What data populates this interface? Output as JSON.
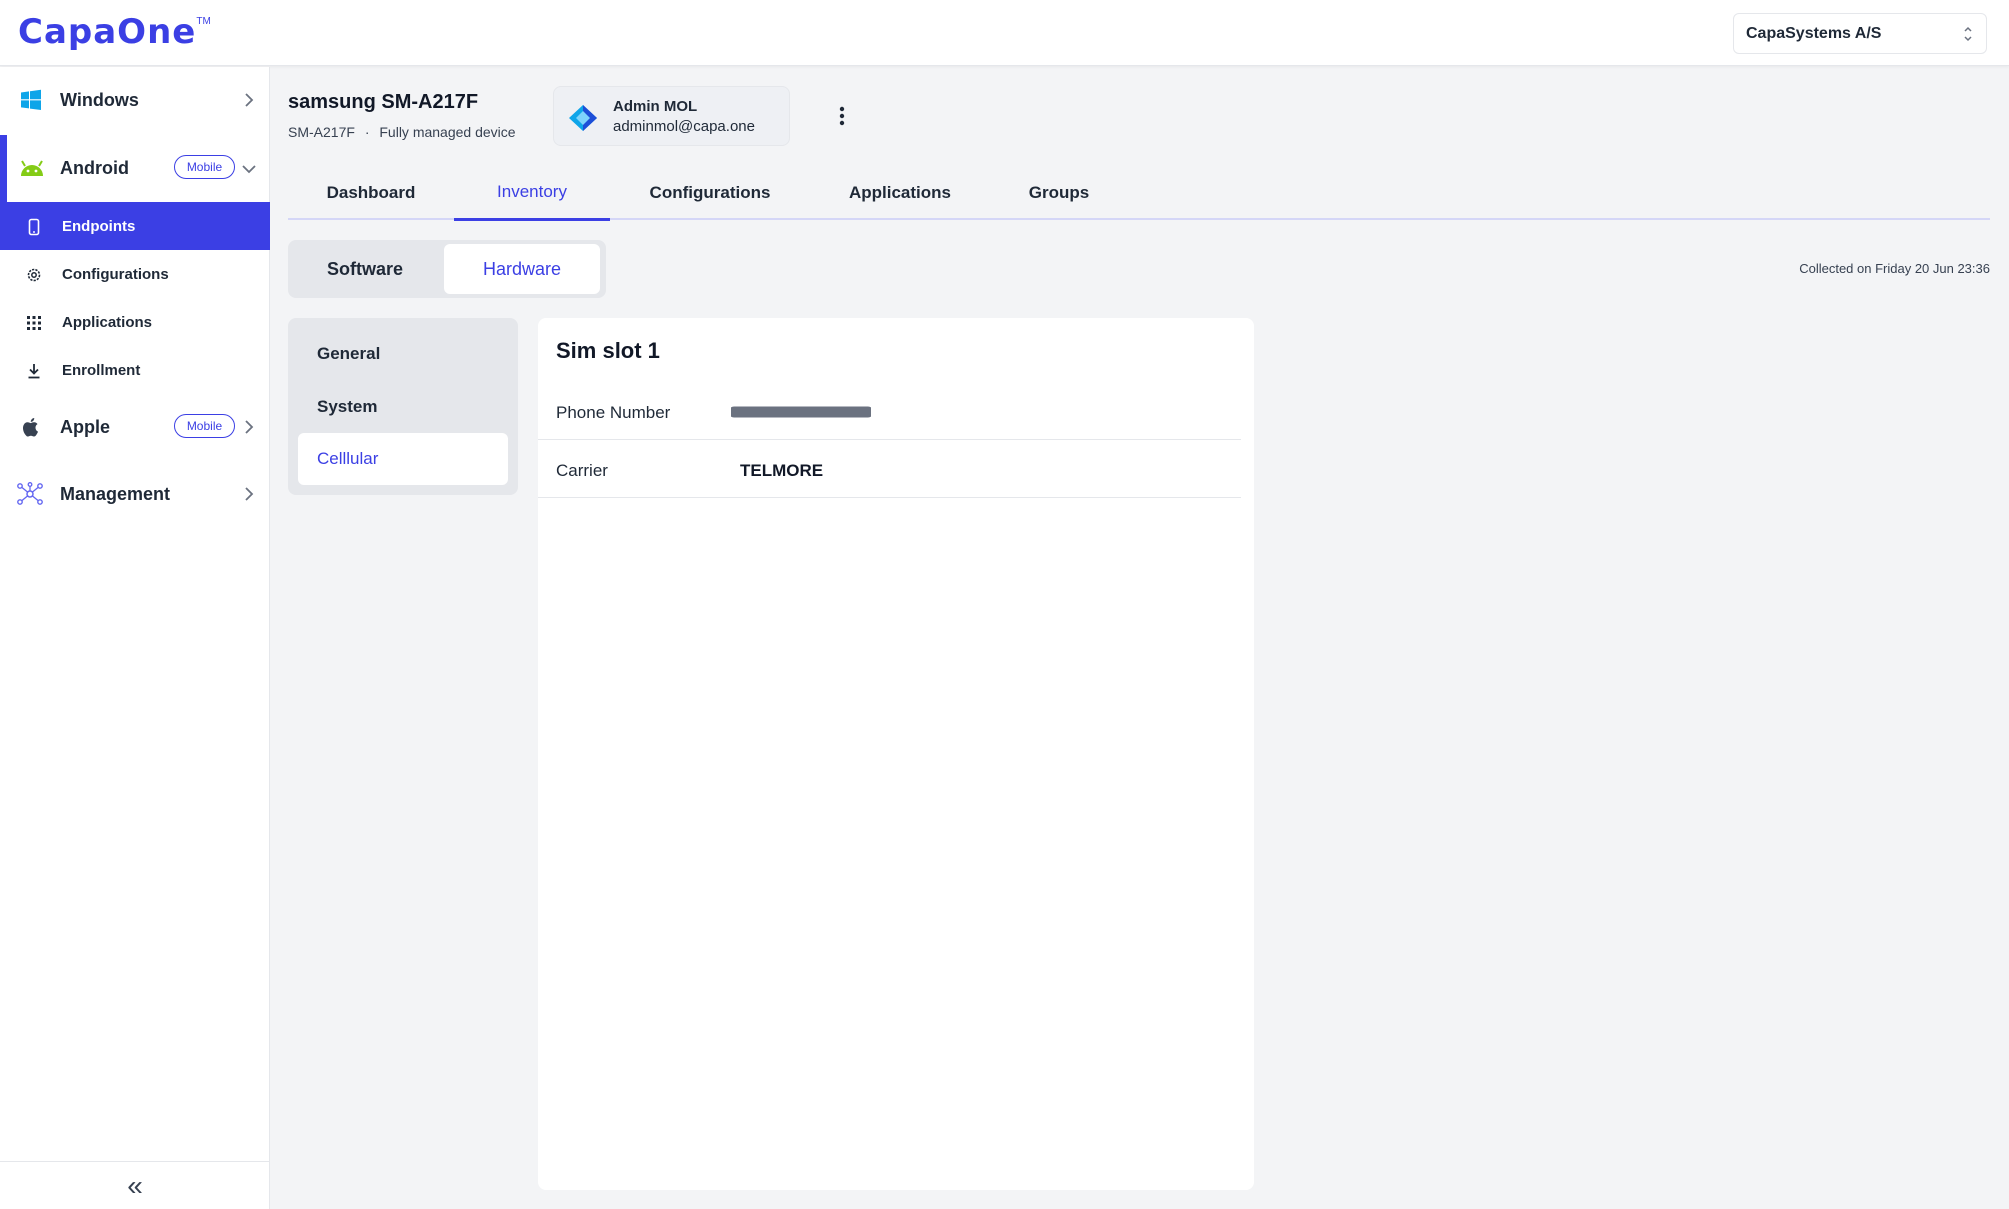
{
  "brand": {
    "logo": "CapaOne",
    "tm": "TM",
    "accent": "#3b3fe4"
  },
  "org_select": {
    "value": "CapaSystems A/S"
  },
  "sidebar": {
    "windows": {
      "label": "Windows"
    },
    "android": {
      "label": "Android",
      "badge": "Mobile"
    },
    "android_items": [
      {
        "label": "Endpoints",
        "icon": "phone-icon"
      },
      {
        "label": "Configurations",
        "icon": "gear-icon"
      },
      {
        "label": "Applications",
        "icon": "grid-icon"
      },
      {
        "label": "Enrollment",
        "icon": "download-icon"
      }
    ],
    "apple": {
      "label": "Apple",
      "badge": "Mobile"
    },
    "management": {
      "label": "Management"
    },
    "collapse": "«"
  },
  "device": {
    "title": "samsung SM-A217F",
    "model": "SM-A217F",
    "separator": "·",
    "mode": "Fully managed device"
  },
  "admin": {
    "name": "Admin MOL",
    "email": "adminmol@capa.one"
  },
  "tabs": [
    "Dashboard",
    "Inventory",
    "Configurations",
    "Applications",
    "Groups"
  ],
  "active_tab": "Inventory",
  "segments": [
    "Software",
    "Hardware"
  ],
  "active_segment": "Hardware",
  "collected": "Collected on Friday 20 Jun 23:36",
  "hardware_nav": [
    "General",
    "System",
    "Celllular"
  ],
  "active_hardware_nav": "Celllular",
  "sim": {
    "title": "Sim slot 1",
    "rows": [
      {
        "label": "Phone Number",
        "value": "",
        "redacted": true
      },
      {
        "label": "Carrier",
        "value": "TELMORE",
        "redacted": false
      }
    ]
  }
}
